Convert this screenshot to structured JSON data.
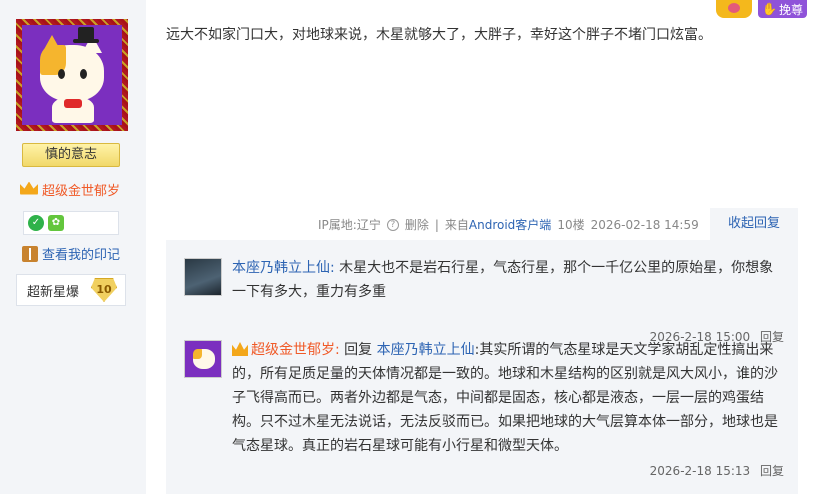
{
  "author": {
    "motto": "慎的意志",
    "level_name": "超级金世郁岁",
    "memo_link": "查看我的印记",
    "star_label": "超新星爆",
    "star_level": "10",
    "badges": [
      "check-badge",
      "leaf-badge"
    ]
  },
  "post": {
    "content": "远大不如家门口大，对地球来说，木星就够大了，大胖子，幸好这个胖子不堵门口炫富。",
    "ip_label": "IP属地:辽宁",
    "delete_label": "删除",
    "sep": "|",
    "source_prefix": "来自",
    "source_link": "Android客户端",
    "floor": "10楼",
    "time": "2026-02-18 14:59",
    "collapse_label": "收起回复"
  },
  "top_widget": {
    "promote_label": "挽尊"
  },
  "replies": [
    {
      "user": "本座乃韩立上仙:",
      "text": "木星大也不是岩石行星，气态行星，那个一千亿公里的原始星，你想象一下有多大，重力有多重",
      "time": "2026-2-18 15:00",
      "reply_label": "回复"
    },
    {
      "user": "超级金世郁岁:",
      "reply_word": "回复",
      "target": "本座乃韩立上仙",
      "text": ":其实所谓的气态星球是天文学家胡乱定性搞出来的，所有足质足量的天体情况都是一致的。地球和木星结构的区别就是风大风小，谁的沙子飞得高而已。两者外边都是气态，中间都是固态，核心都是液态，一层一层的鸡蛋结构。只不过木星无法说话，无法反驳而已。如果把地球的大气层算本体一部分，地球也是气态星球。真正的岩石星球可能有小行星和微型天体。",
      "time": "2026-2-18 15:13",
      "reply_label": "回复"
    }
  ],
  "colors": {
    "link": "#2d64b3",
    "vip_name": "#f05a28",
    "sidebar_bg": "#f3f5f8"
  }
}
